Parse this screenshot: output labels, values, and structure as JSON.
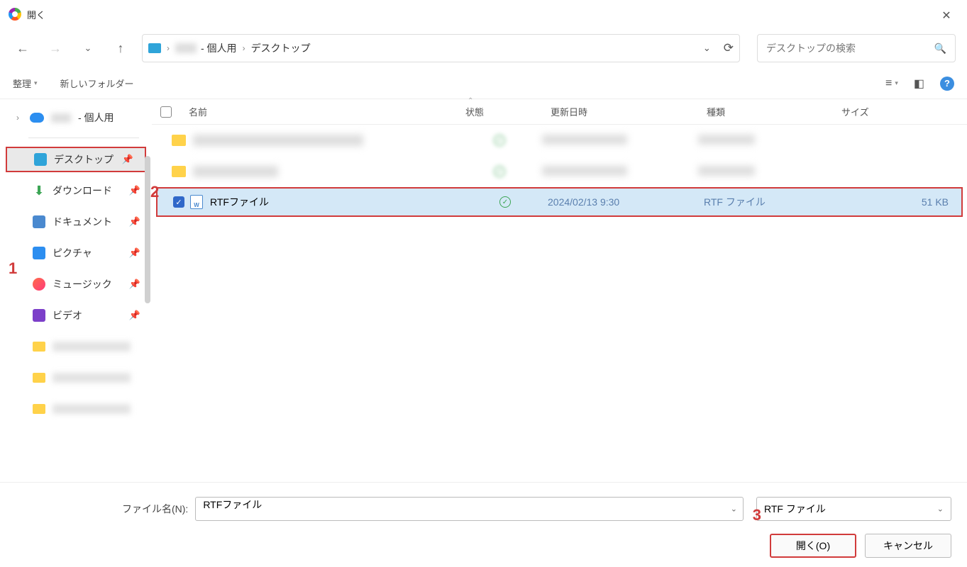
{
  "window": {
    "title": "開く"
  },
  "nav": {
    "breadcrumb": {
      "personal_suffix": "- 個人用",
      "desktop": "デスクトップ"
    },
    "search_placeholder": "デスクトップの検索"
  },
  "toolbar": {
    "organize": "整理",
    "new_folder": "新しいフォルダー"
  },
  "sidebar": {
    "root_personal_suffix": "- 個人用",
    "items": {
      "desktop": "デスクトップ",
      "downloads": "ダウンロード",
      "documents": "ドキュメント",
      "pictures": "ピクチャ",
      "music": "ミュージック",
      "video": "ビデオ"
    }
  },
  "columns": {
    "name": "名前",
    "status": "状態",
    "date": "更新日時",
    "type": "種類",
    "size": "サイズ"
  },
  "files": {
    "selected": {
      "name": "RTFファイル",
      "date": "2024/02/13 9:30",
      "type": "RTF ファイル",
      "size": "51 KB"
    }
  },
  "footer": {
    "filename_label": "ファイル名(N):",
    "filename_value": "RTFファイル",
    "filter_value": "RTF ファイル",
    "open_btn": "開く(O)",
    "cancel_btn": "キャンセル"
  },
  "callouts": {
    "one": "1",
    "two": "2",
    "three": "3"
  }
}
